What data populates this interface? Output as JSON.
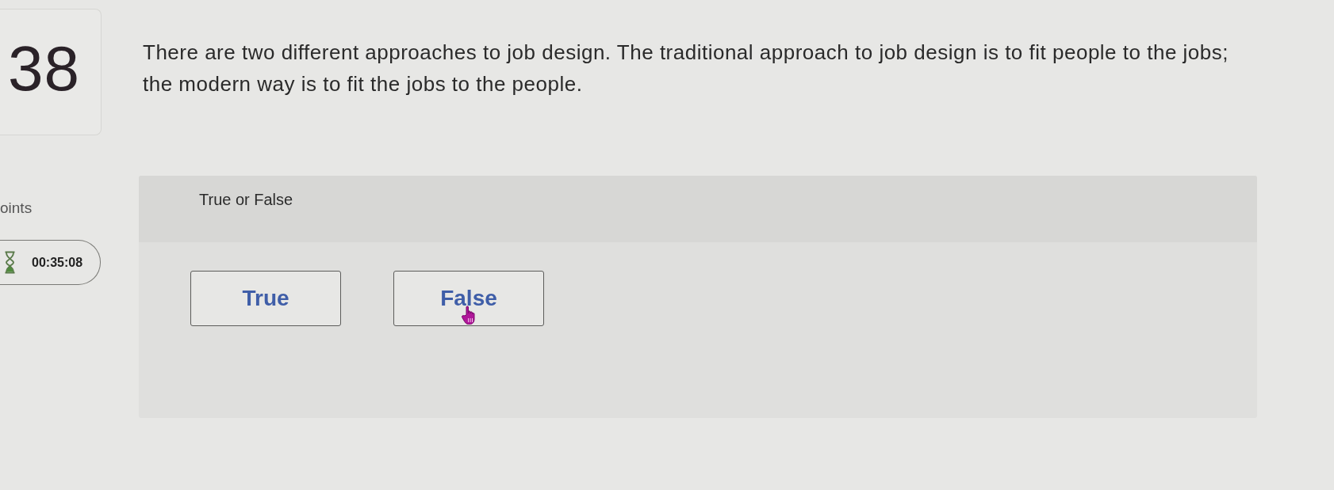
{
  "question": {
    "number": "38",
    "text": "There are two different approaches to job design. The traditional approach to job design is to fit people to the jobs; the modern way is to fit the jobs to the people."
  },
  "sidebar": {
    "points_label": "oints",
    "timer": "00:35:08"
  },
  "answer_panel": {
    "prompt": "True or False",
    "options": [
      {
        "label": "True",
        "selected": false,
        "hovered": false
      },
      {
        "label": "False",
        "selected": false,
        "hovered": true
      }
    ]
  }
}
